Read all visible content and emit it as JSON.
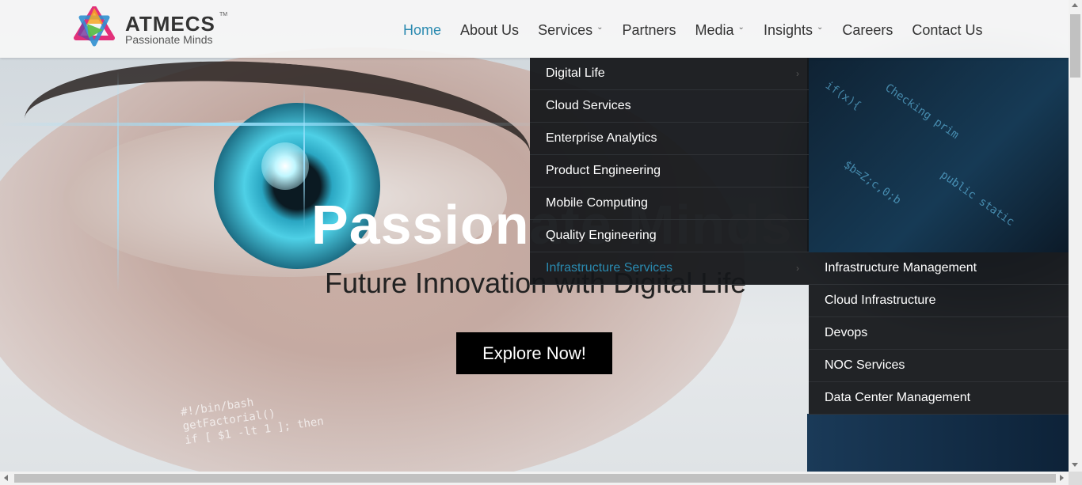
{
  "brand": {
    "name": "ATMECS",
    "trademark": "TM",
    "tagline": "Passionate Minds"
  },
  "nav": {
    "items": [
      {
        "label": "Home",
        "active": true,
        "has_dropdown": false
      },
      {
        "label": "About Us",
        "active": false,
        "has_dropdown": false
      },
      {
        "label": "Services",
        "active": false,
        "has_dropdown": true
      },
      {
        "label": "Partners",
        "active": false,
        "has_dropdown": false
      },
      {
        "label": "Media",
        "active": false,
        "has_dropdown": true
      },
      {
        "label": "Insights",
        "active": false,
        "has_dropdown": true
      },
      {
        "label": "Careers",
        "active": false,
        "has_dropdown": false
      },
      {
        "label": "Contact Us",
        "active": false,
        "has_dropdown": false
      }
    ]
  },
  "services_menu": {
    "items": [
      {
        "label": "Digital Life",
        "has_submenu": true
      },
      {
        "label": "Cloud Services",
        "has_submenu": false
      },
      {
        "label": "Enterprise Analytics",
        "has_submenu": false
      },
      {
        "label": "Product Engineering",
        "has_submenu": false
      },
      {
        "label": "Mobile Computing",
        "has_submenu": false
      },
      {
        "label": "Quality Engineering",
        "has_submenu": false
      },
      {
        "label": "Infrastructure Services",
        "has_submenu": true,
        "active": true
      }
    ],
    "submenu": [
      "Infrastructure Management",
      "Cloud Infrastructure",
      "Devops",
      "NOC Services",
      "Data Center Management"
    ]
  },
  "hero": {
    "title": "Passionate Minds",
    "subtitle": "Future Innovation with Digital Life",
    "cta": "Explore Now!"
  },
  "colors": {
    "accent": "#2a8ab0",
    "menu_bg": "#14161a",
    "cta_bg": "#000000"
  },
  "icons": {
    "dropdown": "chevron-down-icon",
    "submenu": "chevron-right-icon"
  }
}
